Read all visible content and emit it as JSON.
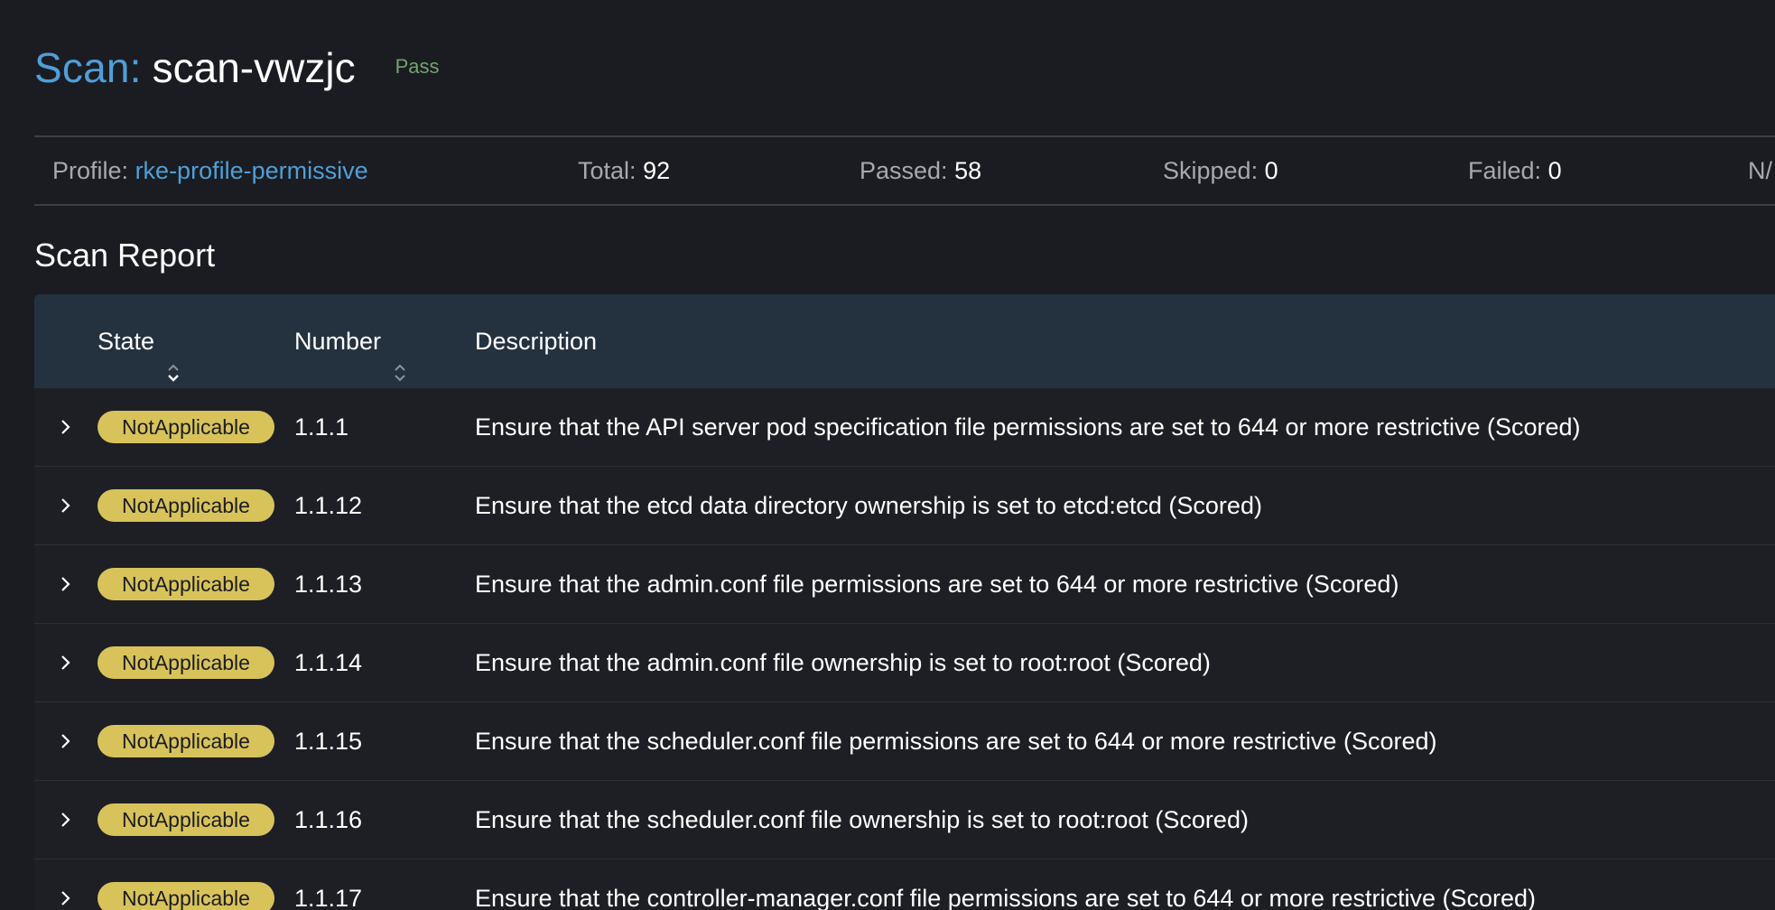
{
  "header": {
    "title_prefix": "Scan:",
    "title_name": "scan-vwzjc",
    "status": "Pass"
  },
  "summary": {
    "profile_label": "Profile:",
    "profile_value": "rke-profile-permissive",
    "total_label": "Total:",
    "total_value": "92",
    "passed_label": "Passed:",
    "passed_value": "58",
    "skipped_label": "Skipped:",
    "skipped_value": "0",
    "failed_label": "Failed:",
    "failed_value": "0",
    "na_label_partial": "N/"
  },
  "report": {
    "section_title": "Scan Report",
    "columns": {
      "state": "State",
      "number": "Number",
      "description": "Description"
    },
    "rows": [
      {
        "state": "NotApplicable",
        "number": "1.1.1",
        "description": "Ensure that the API server pod specification file permissions are set to 644 or more restrictive (Scored)"
      },
      {
        "state": "NotApplicable",
        "number": "1.1.12",
        "description": "Ensure that the etcd data directory ownership is set to etcd:etcd (Scored)"
      },
      {
        "state": "NotApplicable",
        "number": "1.1.13",
        "description": "Ensure that the admin.conf file permissions are set to 644 or more restrictive (Scored)"
      },
      {
        "state": "NotApplicable",
        "number": "1.1.14",
        "description": "Ensure that the admin.conf file ownership is set to root:root (Scored)"
      },
      {
        "state": "NotApplicable",
        "number": "1.1.15",
        "description": "Ensure that the scheduler.conf file permissions are set to 644 or more restrictive (Scored)"
      },
      {
        "state": "NotApplicable",
        "number": "1.1.16",
        "description": "Ensure that the scheduler.conf file ownership is set to root:root (Scored)"
      },
      {
        "state": "NotApplicable",
        "number": "1.1.17",
        "description": "Ensure that the controller-manager.conf file permissions are set to 644 or more restrictive (Scored)"
      }
    ]
  },
  "colors": {
    "accent": "#4f9fd8",
    "pass_text": "#6fa56f",
    "badge_notapplicable": "#d8c35b",
    "table_header": "#24323f",
    "page_background": "#1b1c21"
  },
  "icons": {
    "sort": "sort-icon",
    "expand": "chevron-right-icon"
  }
}
